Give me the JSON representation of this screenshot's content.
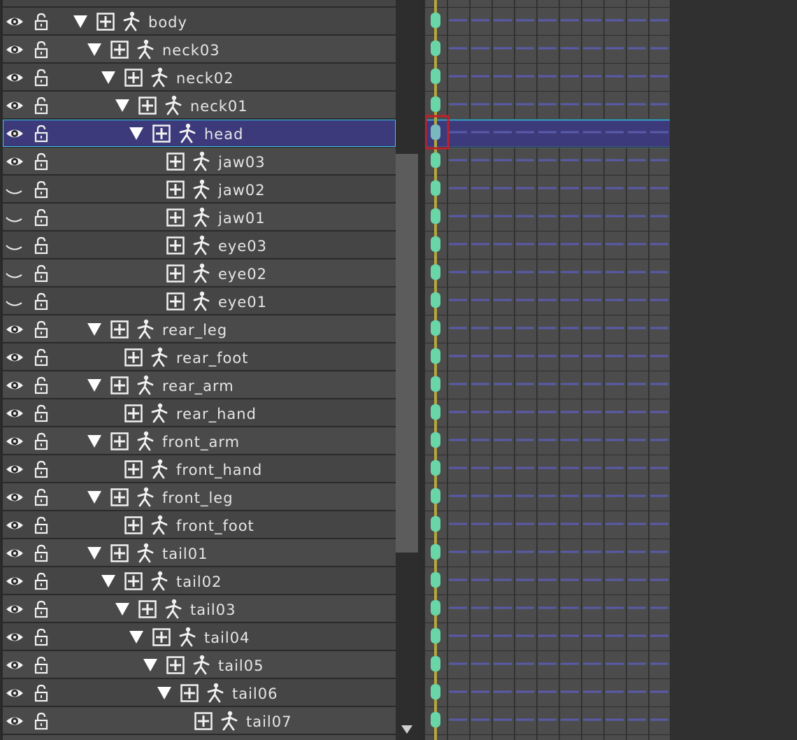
{
  "tree": {
    "rows": [
      {
        "label": "body",
        "depth": 0,
        "expandable": true,
        "visible": true
      },
      {
        "label": "neck03",
        "depth": 1,
        "expandable": true,
        "visible": true
      },
      {
        "label": "neck02",
        "depth": 2,
        "expandable": true,
        "visible": true
      },
      {
        "label": "neck01",
        "depth": 3,
        "expandable": true,
        "visible": true
      },
      {
        "label": "head",
        "depth": 4,
        "expandable": true,
        "visible": true,
        "selected": true
      },
      {
        "label": "jaw03",
        "depth": 5,
        "expandable": false,
        "visible": true
      },
      {
        "label": "jaw02",
        "depth": 5,
        "expandable": false,
        "visible": false
      },
      {
        "label": "jaw01",
        "depth": 5,
        "expandable": false,
        "visible": false
      },
      {
        "label": "eye03",
        "depth": 5,
        "expandable": false,
        "visible": false
      },
      {
        "label": "eye02",
        "depth": 5,
        "expandable": false,
        "visible": false
      },
      {
        "label": "eye01",
        "depth": 5,
        "expandable": false,
        "visible": false
      },
      {
        "label": "rear_leg",
        "depth": 1,
        "expandable": true,
        "visible": true
      },
      {
        "label": "rear_foot",
        "depth": 2,
        "expandable": false,
        "visible": true
      },
      {
        "label": "rear_arm",
        "depth": 1,
        "expandable": true,
        "visible": true
      },
      {
        "label": "rear_hand",
        "depth": 2,
        "expandable": false,
        "visible": true
      },
      {
        "label": "front_arm",
        "depth": 1,
        "expandable": true,
        "visible": true
      },
      {
        "label": "front_hand",
        "depth": 2,
        "expandable": false,
        "visible": true
      },
      {
        "label": "front_leg",
        "depth": 1,
        "expandable": true,
        "visible": true
      },
      {
        "label": "front_foot",
        "depth": 2,
        "expandable": false,
        "visible": true
      },
      {
        "label": "tail01",
        "depth": 1,
        "expandable": true,
        "visible": true
      },
      {
        "label": "tail02",
        "depth": 2,
        "expandable": true,
        "visible": true
      },
      {
        "label": "tail03",
        "depth": 3,
        "expandable": true,
        "visible": true
      },
      {
        "label": "tail04",
        "depth": 4,
        "expandable": true,
        "visible": true
      },
      {
        "label": "tail05",
        "depth": 5,
        "expandable": true,
        "visible": true
      },
      {
        "label": "tail06",
        "depth": 6,
        "expandable": true,
        "visible": true
      },
      {
        "label": "tail07",
        "depth": 7,
        "expandable": false,
        "visible": true
      }
    ]
  },
  "icons": {
    "visibility": "eye-icon",
    "hidden": "eye-closed-icon",
    "lock": "unlock-icon",
    "expand": "expand-triangle-icon",
    "add_key": "plus-box-icon",
    "bone": "bone-figure-icon"
  },
  "colors": {
    "row_bg": "#4a4a4a",
    "selected_bg": "#3c3a7a",
    "selected_border": "#37c8f0",
    "keyframe": "#6ad6a8",
    "playhead": "#b4a83c",
    "frame_dash": "#5a5aaa",
    "selected_key_outline": "#c0202a"
  }
}
